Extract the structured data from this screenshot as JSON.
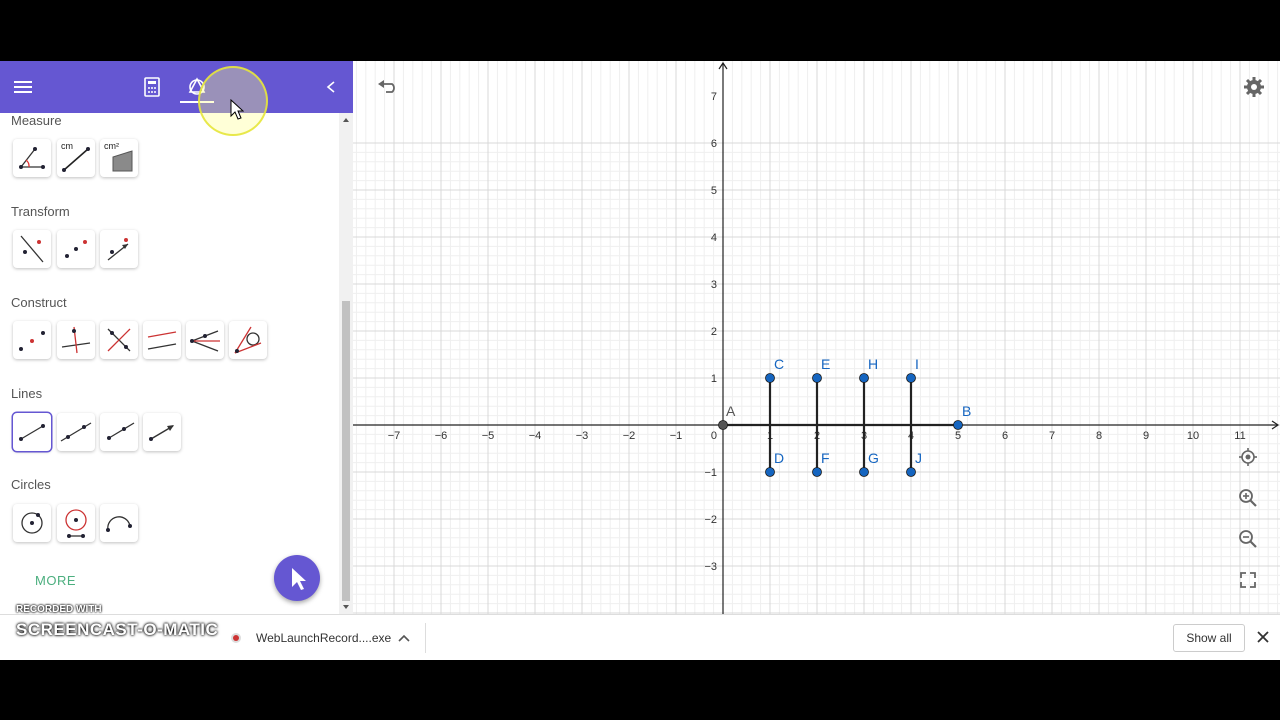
{
  "sidebar": {
    "categories": [
      {
        "label": "Measure"
      },
      {
        "label": "Transform"
      },
      {
        "label": "Construct"
      },
      {
        "label": "Lines"
      },
      {
        "label": "Circles"
      }
    ],
    "tool_labels": {
      "cm": "cm",
      "cm2": "cm²"
    },
    "more_label": "MORE"
  },
  "graph": {
    "x_ticks": [
      "−7",
      "−6",
      "−5",
      "−4",
      "−3",
      "−2",
      "−1",
      "1",
      "2",
      "3",
      "4",
      "5",
      "6",
      "7",
      "8",
      "9",
      "10",
      "11"
    ],
    "y_ticks": [
      "7",
      "6",
      "5",
      "4",
      "3",
      "2",
      "1",
      "−1",
      "−2",
      "−3"
    ],
    "origin_label": "0",
    "points": [
      {
        "label": "A",
        "x": 0,
        "y": 0
      },
      {
        "label": "B",
        "x": 5,
        "y": 0
      },
      {
        "label": "C",
        "x": 1,
        "y": 1
      },
      {
        "label": "D",
        "x": 1,
        "y": -1
      },
      {
        "label": "E",
        "x": 2,
        "y": 1
      },
      {
        "label": "F",
        "x": 2,
        "y": -1
      },
      {
        "label": "H",
        "x": 3,
        "y": 1
      },
      {
        "label": "G",
        "x": 3,
        "y": -1
      },
      {
        "label": "I",
        "x": 4,
        "y": 1
      },
      {
        "label": "J",
        "x": 4,
        "y": -1
      }
    ],
    "segments": [
      [
        "A",
        "B"
      ],
      [
        "C",
        "D"
      ],
      [
        "E",
        "F"
      ],
      [
        "H",
        "G"
      ],
      [
        "I",
        "J"
      ]
    ],
    "colors": {
      "point": "#1565c0",
      "label": "#1565c0",
      "segment": "#222222",
      "grid_major": "#d8d8d8",
      "grid_minor": "#efefef"
    }
  },
  "download_bar": {
    "file_name": "WebLaunchRecord....exe",
    "show_all": "Show all"
  },
  "watermark": {
    "line1": "RECORDED WITH",
    "line2": "SCREENCAST-O-MATIC"
  },
  "theme": {
    "accent": "#6557d2"
  }
}
